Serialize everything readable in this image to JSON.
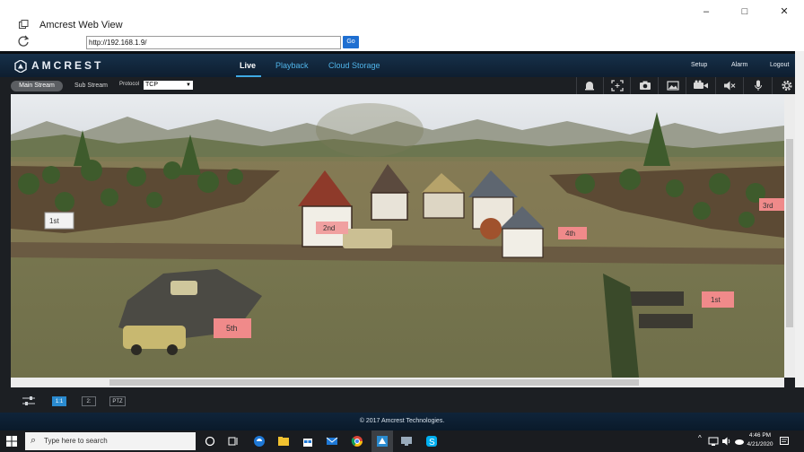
{
  "window": {
    "title": "Amcrest Web View",
    "icon": "app-window-icon",
    "controls": [
      "–",
      "□",
      "✕"
    ]
  },
  "address": {
    "url": "http://192.168.1.9/",
    "go_label": "Go"
  },
  "header": {
    "brand": "AMCREST",
    "tabs": [
      {
        "label": "Live",
        "active": true
      },
      {
        "label": "Playback",
        "active": false
      },
      {
        "label": "Cloud Storage",
        "active": false
      }
    ],
    "links": [
      "Setup",
      "Alarm",
      "Logout"
    ]
  },
  "stream": {
    "main_stream": "Main Stream",
    "sub_stream": "Sub Stream",
    "protocol_label": "Protocol",
    "protocol_value": "TCP",
    "tools": [
      "alarm-bell-icon",
      "fullscreen-region-icon",
      "snapshot-camera-icon",
      "image-icon",
      "record-camera-icon",
      "mute-speaker-icon",
      "microphone-icon",
      "settings-gear-icon"
    ]
  },
  "video": {
    "flag_labels": [
      "1st",
      "2nd",
      "4th",
      "3rd",
      "1st",
      "5th"
    ]
  },
  "controls": {
    "buttons": [
      {
        "label": "1:1",
        "active": true
      },
      {
        "label": "2:",
        "active": false
      },
      {
        "label": "PTZ",
        "active": false
      }
    ]
  },
  "footer": {
    "copyright": "© 2017 Amcrest Technologies."
  },
  "taskbar": {
    "search_placeholder": "Type here to search",
    "time": "4:46 PM",
    "date": "4/21/2020",
    "colors": {
      "edge": "#1e78d6",
      "explorer": "#f2c230",
      "store": "#1e78d6",
      "mail": "#1e78d6",
      "chrome": "#db4437",
      "skype": "#00aff0"
    }
  }
}
